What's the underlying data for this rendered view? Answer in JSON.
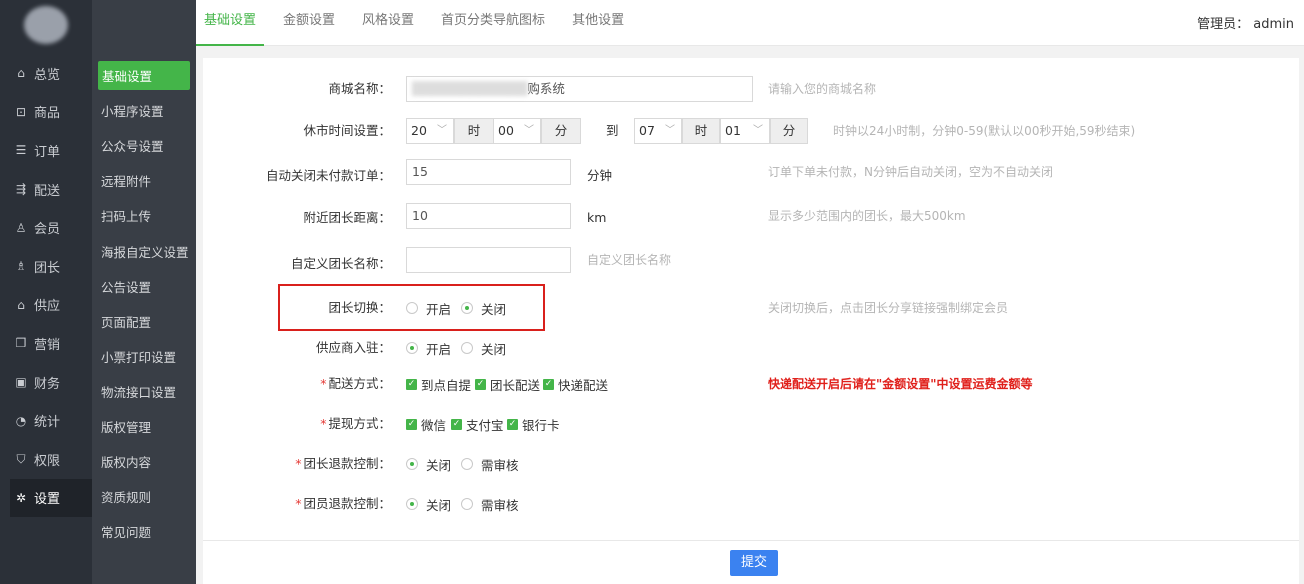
{
  "admin": "管理员： admin",
  "top_tabs": [
    "基础设置",
    "金额设置",
    "风格设置",
    "首页分类导航图标",
    "其他设置"
  ],
  "main_nav": [
    {
      "icon": "home-icon",
      "glyph": "⌂",
      "label": "总览"
    },
    {
      "icon": "shop-icon",
      "glyph": "⊡",
      "label": "商品"
    },
    {
      "icon": "order-icon",
      "glyph": "☰",
      "label": "订单"
    },
    {
      "icon": "delivery-icon",
      "glyph": "⇶",
      "label": "配送"
    },
    {
      "icon": "member-icon",
      "glyph": "♙",
      "label": "会员"
    },
    {
      "icon": "team-icon",
      "glyph": "♗",
      "label": "团长"
    },
    {
      "icon": "supply-icon",
      "glyph": "⌂",
      "label": "供应"
    },
    {
      "icon": "gift-icon",
      "glyph": "❒",
      "label": "营销"
    },
    {
      "icon": "finance-icon",
      "glyph": "▣",
      "label": "财务"
    },
    {
      "icon": "stats-icon",
      "glyph": "◔",
      "label": "统计"
    },
    {
      "icon": "shield-icon",
      "glyph": "⛉",
      "label": "权限"
    },
    {
      "icon": "gear-icon",
      "glyph": "✲",
      "label": "设置"
    }
  ],
  "sub_nav": [
    "基础设置",
    "小程序设置",
    "公众号设置",
    "远程附件",
    "扫码上传",
    "海报自定义设置",
    "公告设置",
    "页面配置",
    "小票打印设置",
    "物流接口设置",
    "版权管理",
    "版权内容",
    "资质规则",
    "常见问题"
  ],
  "form": {
    "shop_name": {
      "label": "商城名称：",
      "value": "购系统",
      "hint": "请输入您的商城名称"
    },
    "closed_time": {
      "label": "休市时间设置：",
      "start_hour": "20",
      "hour_unit": "时",
      "start_min": "00",
      "min_unit": "分",
      "to": "到",
      "end_hour": "07",
      "end_min": "01",
      "hint": "时钟以24小时制，分钟0-59(默认以00秒开始,59秒结束)"
    },
    "auto_close": {
      "label": "自动关闭未付款订单：",
      "value": "15",
      "unit": "分钟",
      "hint": "订单下单未付款，N分钟后自动关闭，空为不自动关闭"
    },
    "nearby_distance": {
      "label": "附近团长距离：",
      "value": "10",
      "unit": "km",
      "hint": "显示多少范围内的团长，最大500km"
    },
    "leader_name": {
      "label": "自定义团长名称：",
      "value": "",
      "hint": "自定义团长名称"
    },
    "leader_switch": {
      "label": "团长切换：",
      "opt1": "开启",
      "opt2": "关闭",
      "selected": "关闭",
      "hint": "关闭切换后，点击团长分享链接强制绑定会员"
    },
    "supplier_join": {
      "label": "供应商入驻：",
      "opt1": "开启",
      "opt2": "关闭",
      "selected": "开启"
    },
    "delivery_method": {
      "label": "配送方式：",
      "options": [
        "到点自提",
        "团长配送",
        "快递配送"
      ],
      "warn": "快递配送开启后请在\"金额设置\"中设置运费金额等"
    },
    "withdraw_method": {
      "label": "提现方式：",
      "options": [
        "微信",
        "支付宝",
        "银行卡"
      ]
    },
    "leader_refund": {
      "label": "团长退款控制：",
      "opt1": "关闭",
      "opt2": "需审核",
      "selected": "关闭"
    },
    "member_refund": {
      "label": "团员退款控制：",
      "opt1": "关闭",
      "opt2": "需审核",
      "selected": "关闭"
    }
  },
  "submit": "提交",
  "colors": {
    "accent": "#44b549",
    "submit": "#3b82f0",
    "highlight": "#d9201c"
  }
}
